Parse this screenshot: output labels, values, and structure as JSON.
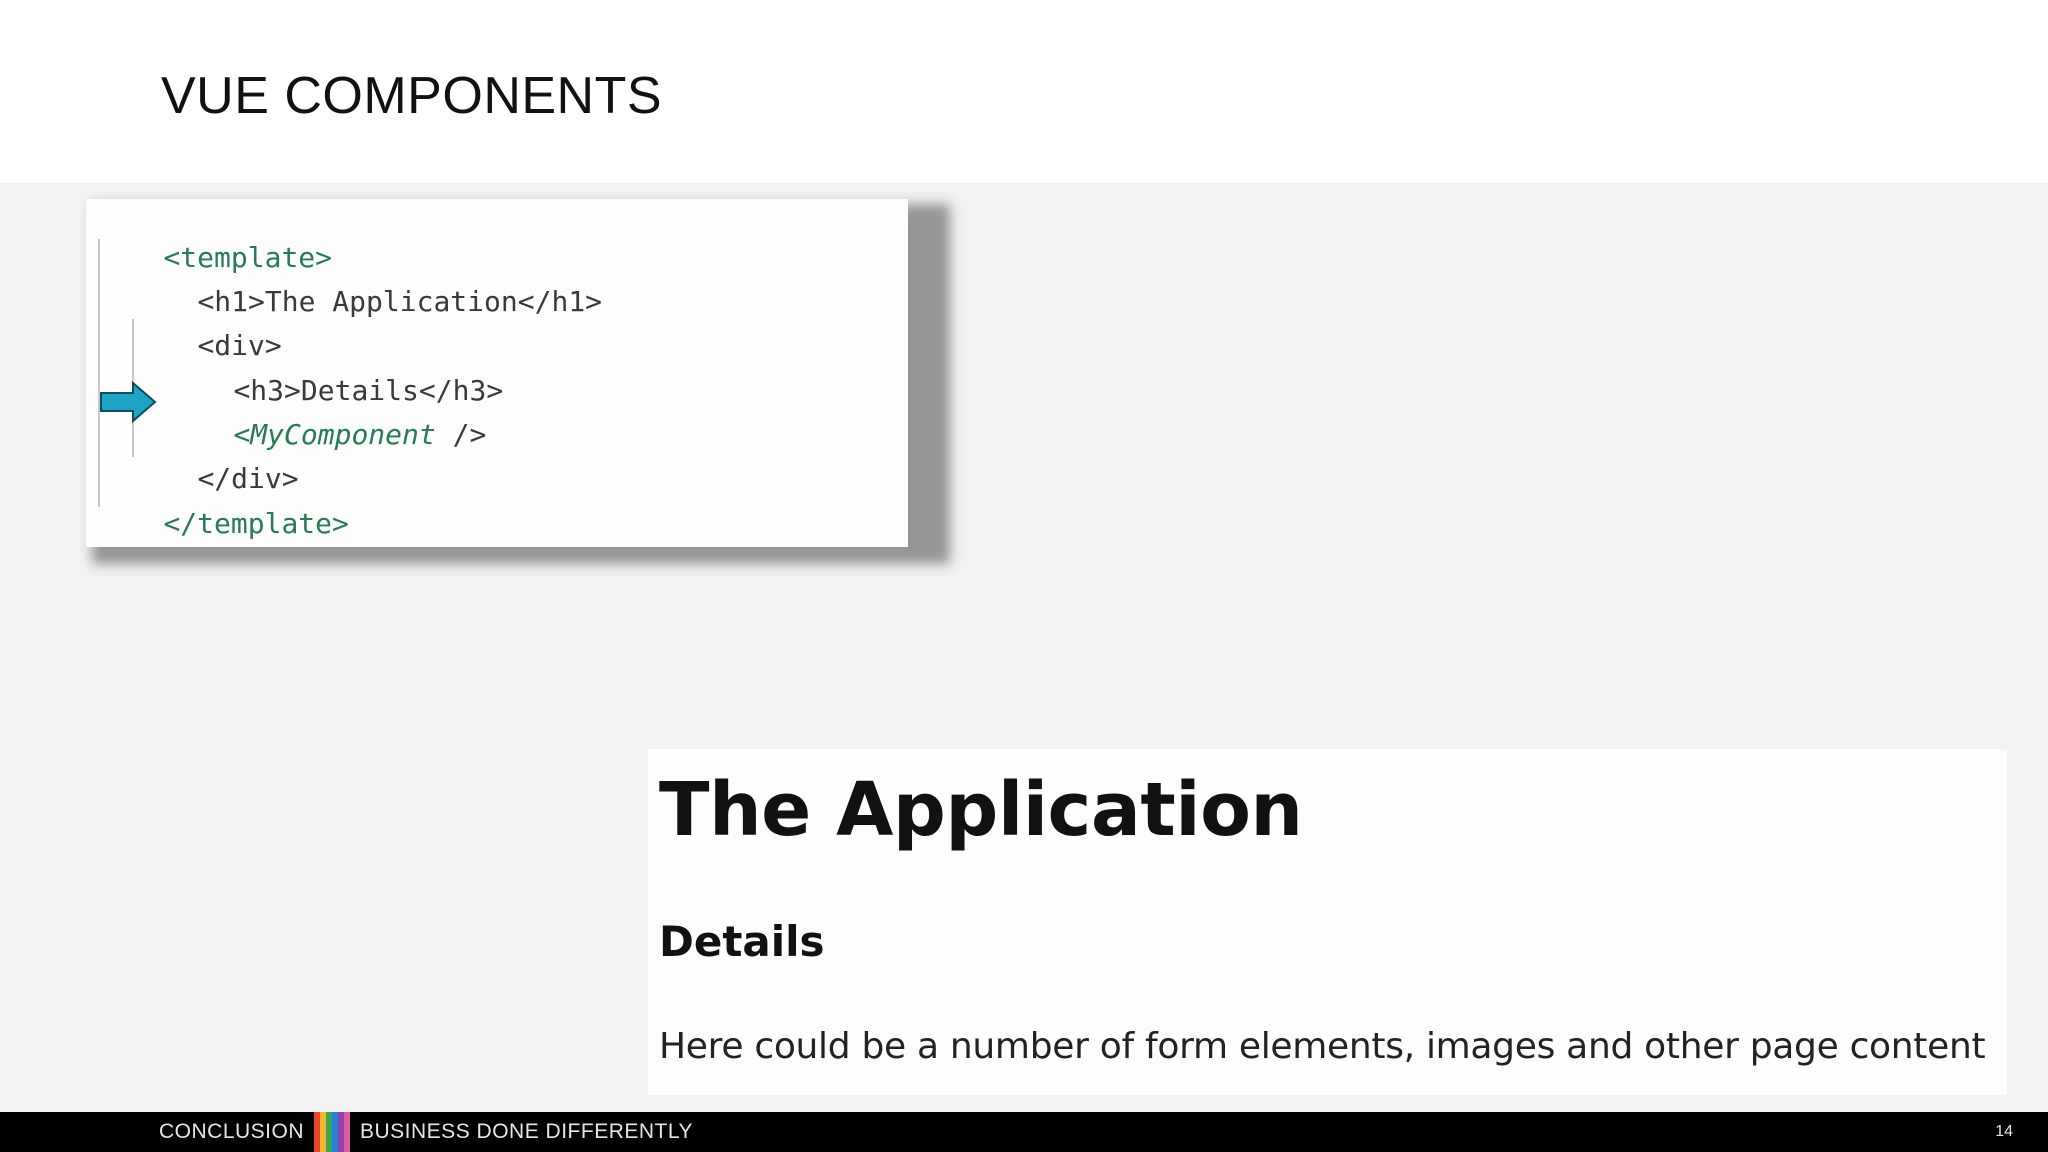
{
  "slide": {
    "title": "VUE COMPONENTS"
  },
  "code_snippet": {
    "lines": [
      {
        "tag": "<template>"
      },
      {
        "open": "<h1>",
        "text": "The Application",
        "close": "</h1>"
      },
      {
        "tag": "<div>"
      },
      {
        "open": "<h3>",
        "text": "Details",
        "close": "</h3>"
      },
      {
        "component": "<MyComponent",
        "rest": " />"
      },
      {
        "tag": "</div>"
      },
      {
        "tag": "</template>"
      }
    ],
    "arrow_icon": "arrow-right-icon",
    "arrow_color": "#1fa3c4"
  },
  "rendered_output": {
    "heading": "The Application",
    "subheading": "Details",
    "content": "Here could be a number of form elements, images and other page content"
  },
  "footer": {
    "brand": "CONCLUSION",
    "tagline": "BUSINESS DONE DIFFERENTLY",
    "page_number": "14",
    "stripe_colors": [
      "#e8452c",
      "#f2b632",
      "#3aa655",
      "#2c7fd6",
      "#8e44ad",
      "#e05aa0"
    ]
  }
}
